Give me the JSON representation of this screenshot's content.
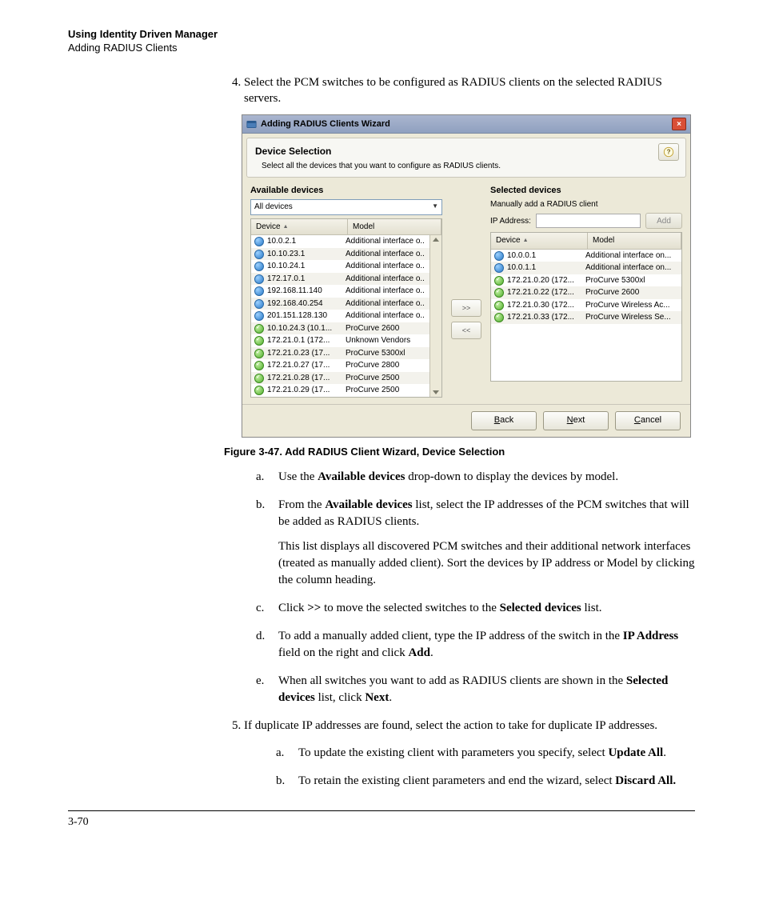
{
  "header": {
    "title": "Using Identity Driven Manager",
    "subtitle": "Adding RADIUS Clients"
  },
  "step4": "Select the PCM switches to be configured as RADIUS clients on the selected RADIUS servers.",
  "dialog": {
    "title": "Adding RADIUS Clients Wizard",
    "section_title": "Device Selection",
    "section_sub": "Select all the devices that you want to configure as RADIUS clients.",
    "available_label": "Available devices",
    "filter": "All devices",
    "col_device": "Device",
    "col_model": "Model",
    "available_rows": [
      {
        "icon": "blue",
        "ip": "10.0.2.1",
        "model": "Additional interface o.."
      },
      {
        "icon": "blue",
        "ip": "10.10.23.1",
        "model": "Additional interface o.."
      },
      {
        "icon": "blue",
        "ip": "10.10.24.1",
        "model": "Additional interface o.."
      },
      {
        "icon": "blue",
        "ip": "172.17.0.1",
        "model": "Additional interface o.."
      },
      {
        "icon": "blue",
        "ip": "192.168.11.140",
        "model": "Additional interface o.."
      },
      {
        "icon": "blue",
        "ip": "192.168.40.254",
        "model": "Additional interface o.."
      },
      {
        "icon": "blue",
        "ip": "201.151.128.130",
        "model": "Additional interface o.."
      },
      {
        "icon": "green",
        "ip": "10.10.24.3 (10.1...",
        "model": "ProCurve 2600"
      },
      {
        "icon": "green",
        "ip": "172.21.0.1 (172...",
        "model": "Unknown Vendors"
      },
      {
        "icon": "green",
        "ip": "172.21.0.23 (17...",
        "model": "ProCurve 5300xl"
      },
      {
        "icon": "green",
        "ip": "172.21.0.27 (17...",
        "model": "ProCurve 2800"
      },
      {
        "icon": "green",
        "ip": "172.21.0.28 (17...",
        "model": "ProCurve 2500"
      },
      {
        "icon": "green",
        "ip": "172.21.0.29 (17...",
        "model": "ProCurve 2500"
      }
    ],
    "move_right": ">>",
    "move_left": "<<",
    "selected_label": "Selected devices",
    "manual_note": "Manually add a RADIUS client",
    "ip_label": "IP Address:",
    "add_label": "Add",
    "selected_rows": [
      {
        "icon": "blue",
        "ip": "10.0.0.1",
        "model": "Additional interface on..."
      },
      {
        "icon": "blue",
        "ip": "10.0.1.1",
        "model": "Additional interface on..."
      },
      {
        "icon": "green",
        "ip": "172.21.0.20 (172...",
        "model": "ProCurve 5300xl"
      },
      {
        "icon": "green",
        "ip": "172.21.0.22 (172...",
        "model": "ProCurve 2600"
      },
      {
        "icon": "green",
        "ip": "172.21.0.30 (172...",
        "model": "ProCurve Wireless Ac..."
      },
      {
        "icon": "green",
        "ip": "172.21.0.33 (172...",
        "model": "ProCurve Wireless Se..."
      }
    ],
    "btn_back": "Back",
    "btn_next": "Next",
    "btn_cancel": "Cancel"
  },
  "figure_caption": "Figure 3-47. Add RADIUS Client Wizard, Device Selection",
  "sub_a_pre": "Use the ",
  "sub_a_b": "Available devices",
  "sub_a_post": " drop-down to display the devices by model.",
  "sub_b_pre": "From the ",
  "sub_b_b": "Available devices",
  "sub_b_post": " list, select the IP addresses of the PCM switches that will be added as RADIUS clients.",
  "sub_b_para2": "This list displays all discovered PCM switches and their additional network interfaces (treated as manually added client). Sort the devices by IP address or Model by clicking the column heading.",
  "sub_c_pre": "Click ",
  "sub_c_b1": ">>",
  "sub_c_mid": " to move the selected switches to the ",
  "sub_c_b2": "Selected devices",
  "sub_c_post": " list.",
  "sub_d_pre": "To add a manually added client, type the IP address of the switch in the ",
  "sub_d_b1": "IP Address",
  "sub_d_mid": " field on the right and click ",
  "sub_d_b2": "Add",
  "sub_d_post": ".",
  "sub_e_pre": "When all switches you want to add as RADIUS clients are shown in the ",
  "sub_e_b1": "Selected devices",
  "sub_e_mid": " list, click ",
  "sub_e_b2": "Next",
  "sub_e_post": ".",
  "step5": "If duplicate IP addresses are found, select the action to take for duplicate IP addresses.",
  "sub5a_pre": "To update the existing client with parameters you specify, select ",
  "sub5a_b": "Update All",
  "sub5a_post": ".",
  "sub5b_pre": "To retain the existing client parameters and end the wizard, select ",
  "sub5b_b": "Discard All.",
  "page_number": "3-70"
}
